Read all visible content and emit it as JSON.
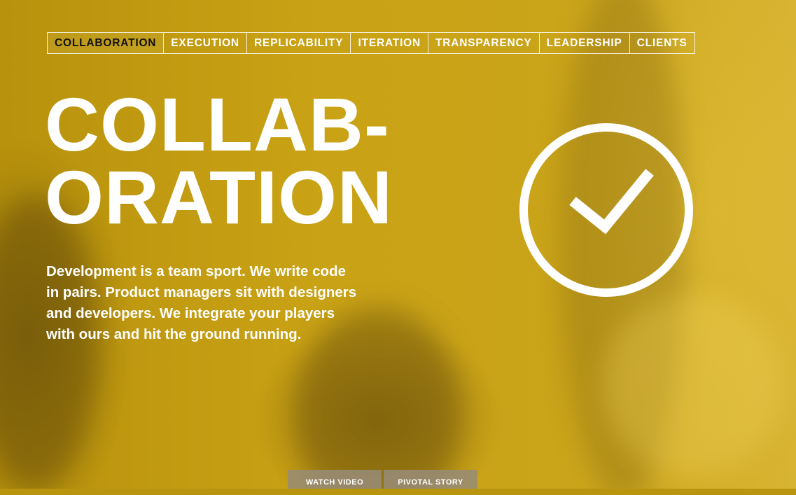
{
  "nav": {
    "items": [
      {
        "label": "COLLABORATION",
        "active": true
      },
      {
        "label": "EXECUTION",
        "active": false
      },
      {
        "label": "REPLICABILITY",
        "active": false
      },
      {
        "label": "ITERATION",
        "active": false
      },
      {
        "label": "TRANSPARENCY",
        "active": false
      },
      {
        "label": "LEADERSHIP",
        "active": false
      },
      {
        "label": "CLIENTS",
        "active": false
      }
    ]
  },
  "hero": {
    "headline_line1": "COLLAB-",
    "headline_line2": "ORATION",
    "description": "Development is a team sport. We write code in pairs. Product managers sit with designers and developers. We integrate your players with ours and hit the ground running.",
    "icon": "check-circle-icon"
  },
  "buttons": {
    "watch_video": "WATCH VIDEO",
    "pivotal_story": "PIVOTAL STORY"
  },
  "colors": {
    "overlay": "#c9a215",
    "text": "#ffffff",
    "active_nav_text": "#111111"
  }
}
